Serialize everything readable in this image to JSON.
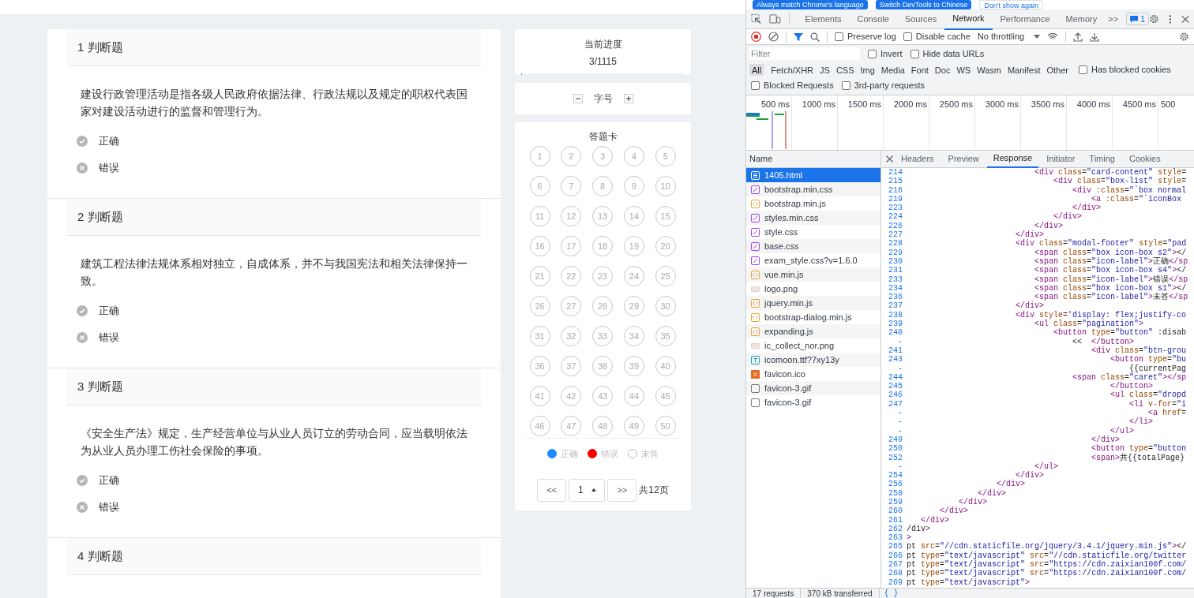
{
  "page": {
    "questions": [
      {
        "title": "1 判断题",
        "text": "建设行政管理活动是指各级人民政府依据法律、行政法规以及规定的职权代表国家对建设活动进行的监督和管理行为。",
        "options": [
          {
            "kind": "correct",
            "label": "正确",
            "selected": false
          },
          {
            "kind": "wrong",
            "label": "错误",
            "selected": false
          }
        ]
      },
      {
        "title": "2 判断题",
        "text": "建筑工程法律法规体系相对独立，自成体系，并不与我国宪法和相关法律保持一致。",
        "options": [
          {
            "kind": "correct",
            "label": "正确",
            "selected": false
          },
          {
            "kind": "wrong",
            "label": "错误",
            "selected": false
          }
        ]
      },
      {
        "title": "3 判断题",
        "text": "《安全生产法》规定，生产经营单位与从业人员订立的劳动合同，应当载明依法为从业人员办理工伤社会保险的事项。",
        "options": [
          {
            "kind": "correct",
            "label": "正确",
            "selected": false
          },
          {
            "kind": "wrong",
            "label": "错误",
            "selected": false
          }
        ]
      },
      {
        "title": "4 判断题"
      }
    ],
    "progress": {
      "title": "当前进度",
      "value": "3/1115",
      "level": 0.003
    },
    "font_size": {
      "label": "字号"
    },
    "answer_card": {
      "title": "答题卡",
      "numbers": [
        "1",
        "2",
        "3",
        "4",
        "5",
        "6",
        "7",
        "8",
        "9",
        "10",
        "11",
        "12",
        "13",
        "14",
        "15",
        "16",
        "17",
        "18",
        "19",
        "20",
        "21",
        "22",
        "23",
        "24",
        "25",
        "26",
        "27",
        "28",
        "29",
        "30",
        "31",
        "32",
        "33",
        "34",
        "35",
        "36",
        "37",
        "38",
        "39",
        "40",
        "41",
        "42",
        "43",
        "44",
        "45",
        "46",
        "47",
        "48",
        "49",
        "50"
      ],
      "legend": [
        {
          "label": "正确",
          "color": "#1a8cff",
          "filled": true
        },
        {
          "label": "错误",
          "color": "#ff0000",
          "filled": true
        },
        {
          "label": "未答",
          "color": "#bbbbbb",
          "filled": false
        }
      ]
    },
    "pagination": {
      "prev": "<<",
      "page": "1",
      "next": ">>",
      "total": "共12页"
    }
  },
  "devtools": {
    "banner_buttons": [
      {
        "label": "Always match Chrome's language",
        "primary": true
      },
      {
        "label": "Switch DevTools to Chinese",
        "primary": true
      },
      {
        "label": "Don't show again",
        "primary": false
      }
    ],
    "tabs": [
      {
        "label": "Elements",
        "selected": false
      },
      {
        "label": "Console",
        "selected": false
      },
      {
        "label": "Sources",
        "selected": false
      },
      {
        "label": "Network",
        "selected": true
      },
      {
        "label": "Performance",
        "selected": false
      },
      {
        "label": "Memory",
        "selected": false
      }
    ],
    "more": ">>",
    "issues_badge": "1",
    "toolbar": {
      "recording": true,
      "checkboxes": [
        {
          "label": "Preserve log",
          "checked": false
        },
        {
          "label": "Disable cache",
          "checked": false
        }
      ],
      "throttling": "No throttling"
    },
    "filter": {
      "placeholder": "Filter",
      "checkboxes": [
        {
          "label": "Invert",
          "checked": false
        },
        {
          "label": "Hide data URLs",
          "checked": false
        }
      ]
    },
    "type_filters": [
      {
        "label": "All",
        "selected": true
      },
      {
        "label": "Fetch/XHR",
        "selected": false
      },
      {
        "label": "JS",
        "selected": false
      },
      {
        "label": "CSS",
        "selected": false
      },
      {
        "label": "Img",
        "selected": false
      },
      {
        "label": "Media",
        "selected": false
      },
      {
        "label": "Font",
        "selected": false
      },
      {
        "label": "Doc",
        "selected": false
      },
      {
        "label": "WS",
        "selected": false
      },
      {
        "label": "Wasm",
        "selected": false
      },
      {
        "label": "Manifest",
        "selected": false
      },
      {
        "label": "Other",
        "selected": false
      }
    ],
    "blocked_cookies": {
      "label": "Has blocked cookies",
      "checked": false
    },
    "request_checkboxes": [
      {
        "label": "Blocked Requests",
        "checked": false
      },
      {
        "label": "3rd-party requests",
        "checked": false
      }
    ],
    "timeline_ticks": [
      "500 ms",
      "1000 ms",
      "1500 ms",
      "2000 ms",
      "2500 ms",
      "3000 ms",
      "3500 ms",
      "4000 ms",
      "4500 ms",
      "500"
    ],
    "requests": {
      "header": "Name",
      "rows": [
        {
          "name": "1405.html",
          "kind": "doc",
          "selected": true
        },
        {
          "name": "bootstrap.min.css",
          "kind": "css",
          "selected": false
        },
        {
          "name": "bootstrap.min.js",
          "kind": "js",
          "selected": false
        },
        {
          "name": "styles.min.css",
          "kind": "css",
          "selected": false
        },
        {
          "name": "style.css",
          "kind": "css",
          "selected": false
        },
        {
          "name": "base.css",
          "kind": "css",
          "selected": false
        },
        {
          "name": "exam_style.css?v=1.6.0",
          "kind": "css",
          "selected": false
        },
        {
          "name": "vue.min.js",
          "kind": "js",
          "selected": false
        },
        {
          "name": "logo.png",
          "kind": "img",
          "selected": false
        },
        {
          "name": "jquery.min.js",
          "kind": "js",
          "selected": false
        },
        {
          "name": "bootstrap-dialog.min.js",
          "kind": "js",
          "selected": false
        },
        {
          "name": "expanding.js",
          "kind": "js",
          "selected": false
        },
        {
          "name": "ic_collect_nor.png",
          "kind": "img",
          "selected": false
        },
        {
          "name": "icomoon.ttf?7xy13y",
          "kind": "font",
          "selected": false
        },
        {
          "name": "favicon.ico",
          "kind": "ico",
          "selected": false
        },
        {
          "name": "favicon-3.gif",
          "kind": "gif",
          "selected": false
        },
        {
          "name": "favicon-3.gif",
          "kind": "gif",
          "selected": false
        }
      ],
      "summary": [
        "17 requests",
        "370 kB transferred"
      ],
      "pretty_print": "{ }"
    },
    "detail": {
      "tabs": [
        {
          "label": "Headers",
          "selected": false
        },
        {
          "label": "Preview",
          "selected": false
        },
        {
          "label": "Response",
          "selected": true
        },
        {
          "label": "Initiator",
          "selected": false
        },
        {
          "label": "Timing",
          "selected": false
        },
        {
          "label": "Cookies",
          "selected": false
        }
      ],
      "lines": [
        {
          "number": "214",
          "code": "                           <div class=\"card-content\" style="
        },
        {
          "number": "215",
          "code": "                               <div class=\"box-list\" style="
        },
        {
          "number": "216",
          "code": "                                   <div :class=\"`box normal"
        },
        {
          "number": "219",
          "code": "                                       <a :class=\"`iconBox"
        },
        {
          "number": "223",
          "code": "                                   </div>"
        },
        {
          "number": "224",
          "code": "                               </div>"
        },
        {
          "number": "226",
          "code": "                           </div>"
        },
        {
          "number": "227",
          "code": "                       </div>"
        },
        {
          "number": "228",
          "code": "                       <div class=\"modal-footer\" style=\"pad"
        },
        {
          "number": "229",
          "code": "                           <span class=\"box icon-box s2\"></"
        },
        {
          "number": "230",
          "code": "                           <span class=\"icon-label\">正确</sp"
        },
        {
          "number": "231",
          "code": "                           <span class=\"box icon-box s4\"></"
        },
        {
          "number": "233",
          "code": "                           <span class=\"icon-label\">错误</sp"
        },
        {
          "number": "234",
          "code": "                           <span class=\"box icon-box s1\"></"
        },
        {
          "number": "236",
          "code": "                           <span class=\"icon-label\">未答</sp"
        },
        {
          "number": "237",
          "code": "                       </div>"
        },
        {
          "number": "238",
          "code": "                       <div style='display: flex;justify-co"
        },
        {
          "number": "239",
          "code": "                           <ul class=\"pagination\">"
        },
        {
          "number": "240",
          "code": "                               <button type=\"button\" :disab"
        },
        {
          "number": "-",
          "code": "                                   <<  </button>"
        },
        {
          "number": "241",
          "code": "                                       <div class=\"btn-grou"
        },
        {
          "number": "243",
          "code": "                                           <button type=\"bu"
        },
        {
          "number": "-",
          "code": "                                               {{currentPag"
        },
        {
          "number": "244",
          "code": "                                   <span class=\"caret\"></sp"
        },
        {
          "number": "245",
          "code": "                                           </button>"
        },
        {
          "number": "246",
          "code": "                                           <ul class=\"dropd"
        },
        {
          "number": "247",
          "code": "                                               <li v-for=\"i"
        },
        {
          "number": "-",
          "code": "                                                   <a href="
        },
        {
          "number": "-",
          "code": "                                               </li>"
        },
        {
          "number": "-",
          "code": "                                           </ul>"
        },
        {
          "number": "249",
          "code": "                                       </div>"
        },
        {
          "number": "250",
          "code": "                                       <button type=\"button"
        },
        {
          "number": "252",
          "code": "                                       <span>共{{totalPage}"
        },
        {
          "number": "-",
          "code": "                           </ul>"
        },
        {
          "number": "254",
          "code": "                       </div>"
        },
        {
          "number": "256",
          "code": "                   </div>"
        },
        {
          "number": "258",
          "code": "               </div>"
        },
        {
          "number": "259",
          "code": "           </div>"
        },
        {
          "number": "260",
          "code": "       </div>"
        },
        {
          "number": "261",
          "code": "   </div>"
        },
        {
          "number": "262",
          "code": "/div>"
        },
        {
          "number": "263",
          "code": ">"
        },
        {
          "number": "265",
          "code": "pt src=\"//cdn.staticfile.org/jquery/3.4.1/jquery.min.js\"></"
        },
        {
          "number": "266",
          "code": "pt type=\"text/javascript\" src=\"//cdn.staticfile.org/twitter"
        },
        {
          "number": "267",
          "code": "pt type=\"text/javascript\" src=\"https://cdn.zaixian100f.com/"
        },
        {
          "number": "268",
          "code": "pt type=\"text/javascript\" src=\"https://cdn.zaixian100f.com/"
        },
        {
          "number": "269",
          "code": "pt type=\"text/javascript\">"
        }
      ]
    }
  }
}
